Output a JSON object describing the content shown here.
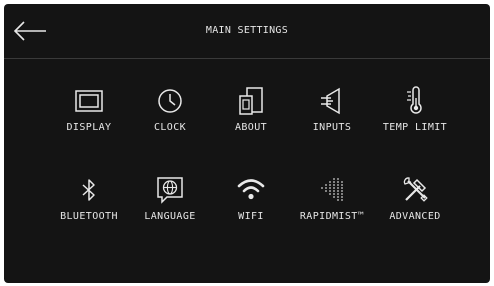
{
  "header": {
    "title": "MAIN SETTINGS"
  },
  "icons": {
    "back": "back-arrow-icon"
  },
  "menu": {
    "items": [
      {
        "label": "DISPLAY",
        "icon": "display-icon"
      },
      {
        "label": "CLOCK",
        "icon": "clock-icon"
      },
      {
        "label": "ABOUT",
        "icon": "devices-icon"
      },
      {
        "label": "INPUTS",
        "icon": "inputs-icon"
      },
      {
        "label": "TEMP LIMIT",
        "icon": "thermometer-icon"
      },
      {
        "label": "BLUETOOTH",
        "icon": "bluetooth-icon"
      },
      {
        "label": "LANGUAGE",
        "icon": "globe-chat-icon"
      },
      {
        "label": "WIFI",
        "icon": "wifi-icon"
      },
      {
        "label": "RAPIDMIST™",
        "icon": "mist-icon"
      },
      {
        "label": "ADVANCED",
        "icon": "tools-icon"
      }
    ]
  },
  "colors": {
    "background": "#141414",
    "foreground": "#e8e8e8",
    "divider": "#3a3a3a"
  }
}
